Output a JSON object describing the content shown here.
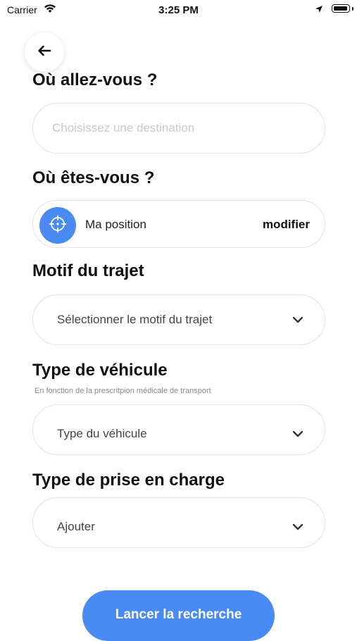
{
  "status_bar": {
    "carrier": "Carrier",
    "time": "3:25 PM"
  },
  "icons": {
    "back": "arrow-left-icon",
    "wifi": "wifi-icon",
    "location_arrow": "location-arrow-icon",
    "battery": "battery-icon",
    "crosshair": "crosshair-icon",
    "chevron": "chevron-down-icon"
  },
  "colors": {
    "accent": "#4a8af3",
    "placeholder": "#c9c9c9",
    "border": "#e3e3e3"
  },
  "destination": {
    "title": "Où allez-vous ?",
    "placeholder": "Choisissez une destination"
  },
  "origin": {
    "title": "Où êtes-vous ?",
    "value": "Ma position",
    "modify_label": "modifier"
  },
  "trip_reason": {
    "title": "Motif du trajet",
    "value": "Sélectionner le motif du trajet"
  },
  "vehicle_type": {
    "title": "Type de véhicule",
    "subtitle": "En fonction de la prescritpion médicale de transport",
    "value": "Type du véhicule"
  },
  "care_type": {
    "title": "Type de prise en charge",
    "value": "Ajouter"
  },
  "actions": {
    "search_label": "Lancer la recherche"
  }
}
